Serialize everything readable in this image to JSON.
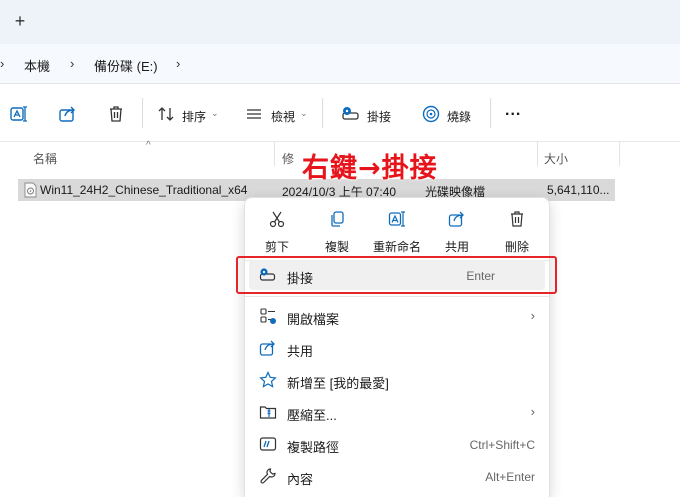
{
  "tabbar": {
    "new_tab_glyph": "+"
  },
  "breadcrumb": {
    "items": [
      "本機",
      "備份碟 (E:)"
    ]
  },
  "commandbar": {
    "sort_label": "排序",
    "view_label": "檢視",
    "mount_label": "掛接",
    "burn_label": "燒錄",
    "more_glyph": "..."
  },
  "columns": {
    "name": "名稱",
    "modified": "修",
    "size": "大小"
  },
  "file": {
    "name": "Win11_24H2_Chinese_Traditional_x64",
    "modified": "2024/10/3 上午 07:40",
    "type": "光碟映像檔",
    "size": "5,641,110..."
  },
  "annotation": {
    "text": "右鍵→掛接",
    "color": "#e8141b"
  },
  "context_menu": {
    "quick_actions": [
      {
        "label": "剪下",
        "icon": "cut-icon"
      },
      {
        "label": "複製",
        "icon": "copy-icon"
      },
      {
        "label": "重新命名",
        "icon": "rename-icon"
      },
      {
        "label": "共用",
        "icon": "share-icon"
      },
      {
        "label": "刪除",
        "icon": "delete-icon"
      }
    ],
    "items": [
      {
        "label": "掛接",
        "shortcut": "Enter",
        "icon": "mount-icon"
      },
      {
        "label": "開啟檔案",
        "icon": "open-with-icon",
        "submenu": true
      },
      {
        "label": "共用",
        "icon": "share-icon"
      },
      {
        "label": "新增至 [我的最愛]",
        "icon": "star-icon"
      },
      {
        "label": "壓縮至...",
        "icon": "zip-icon",
        "submenu": true
      },
      {
        "label": "複製路徑",
        "shortcut": "Ctrl+Shift+C",
        "icon": "copy-path-icon"
      },
      {
        "label": "內容",
        "shortcut": "Alt+Enter",
        "icon": "properties-icon"
      }
    ]
  },
  "colors": {
    "accent": "#0f6cbd",
    "highlight_box": "#e52528",
    "selection": "#d9d9d9"
  }
}
